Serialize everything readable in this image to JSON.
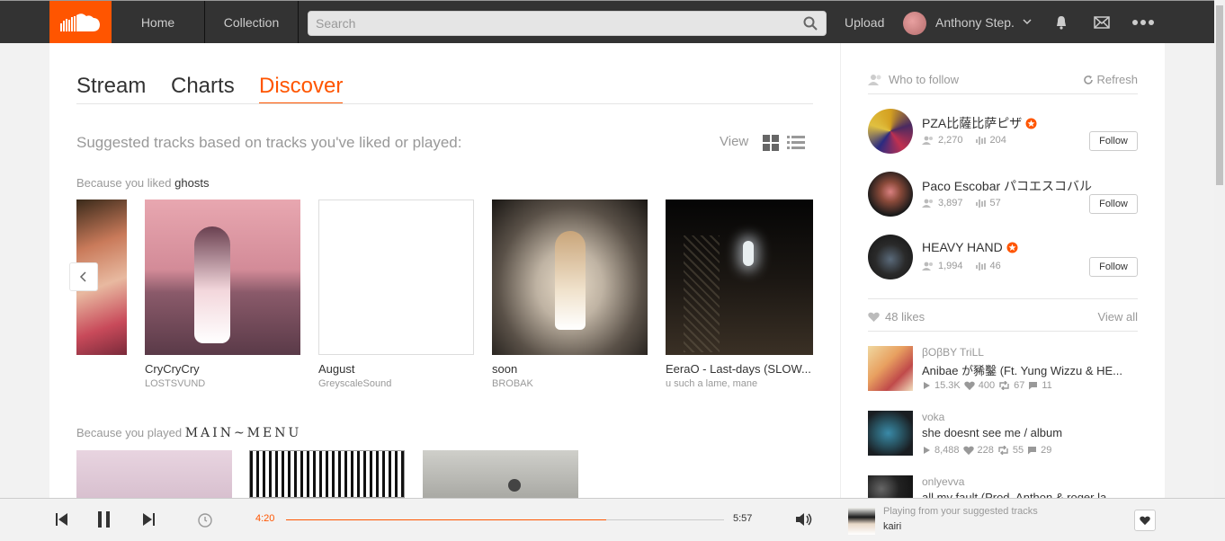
{
  "nav": {
    "home": "Home",
    "collection": "Collection",
    "search_placeholder": "Search",
    "upload": "Upload",
    "username": "Anthony Step."
  },
  "tabs": [
    {
      "label": "Stream"
    },
    {
      "label": "Charts"
    },
    {
      "label": "Discover"
    }
  ],
  "accent_color": "#ff5500",
  "discover": {
    "subtitle": "Suggested tracks based on tracks you've liked or played:",
    "view_label": "View",
    "row1": {
      "prefix": "Because you liked",
      "highlight": "ghosts"
    },
    "row2": {
      "prefix": "Because you played",
      "highlight": "MAIN~MENU"
    },
    "tracks": [
      {
        "title": "CryCryCry",
        "user": "LOSTSVUND"
      },
      {
        "title": "August",
        "user": "GreyscaleSound"
      },
      {
        "title": "soon",
        "user": "BROBAK"
      },
      {
        "title": "EeraO - Last-days (SLOW...",
        "user": "u such a lame, mane"
      }
    ]
  },
  "sidebar": {
    "who_to_follow": "Who to follow",
    "refresh": "Refresh",
    "follow_label": "Follow",
    "suggestions": [
      {
        "name": "PZA比薩比萨ピザ",
        "followers": "2,270",
        "tracks": "204",
        "pro": true
      },
      {
        "name": "Paco Escobar パコエスコバル",
        "followers": "3,897",
        "tracks": "57",
        "pro": false
      },
      {
        "name": "HEAVY HAND",
        "followers": "1,994",
        "tracks": "46",
        "pro": true
      }
    ],
    "likes_count": "48 likes",
    "view_all": "View all",
    "liked_tracks": [
      {
        "user": "βOβBY TriLL",
        "title": "Anibae が豨鑿 (Ft. Yung Wizzu & HE...",
        "plays": "15.3K",
        "likes": "400",
        "reposts": "67",
        "comments": "11"
      },
      {
        "user": "voka",
        "title": "she doesnt see me / album",
        "plays": "8,488",
        "likes": "228",
        "reposts": "55",
        "comments": "29"
      },
      {
        "user": "onlyevva",
        "title": "all my fault (Prod. Anthon & roger la..."
      }
    ]
  },
  "player": {
    "elapsed": "4:20",
    "duration": "5:57",
    "progress": 0.73,
    "context": "Playing from your suggested tracks",
    "track": "kairi"
  }
}
